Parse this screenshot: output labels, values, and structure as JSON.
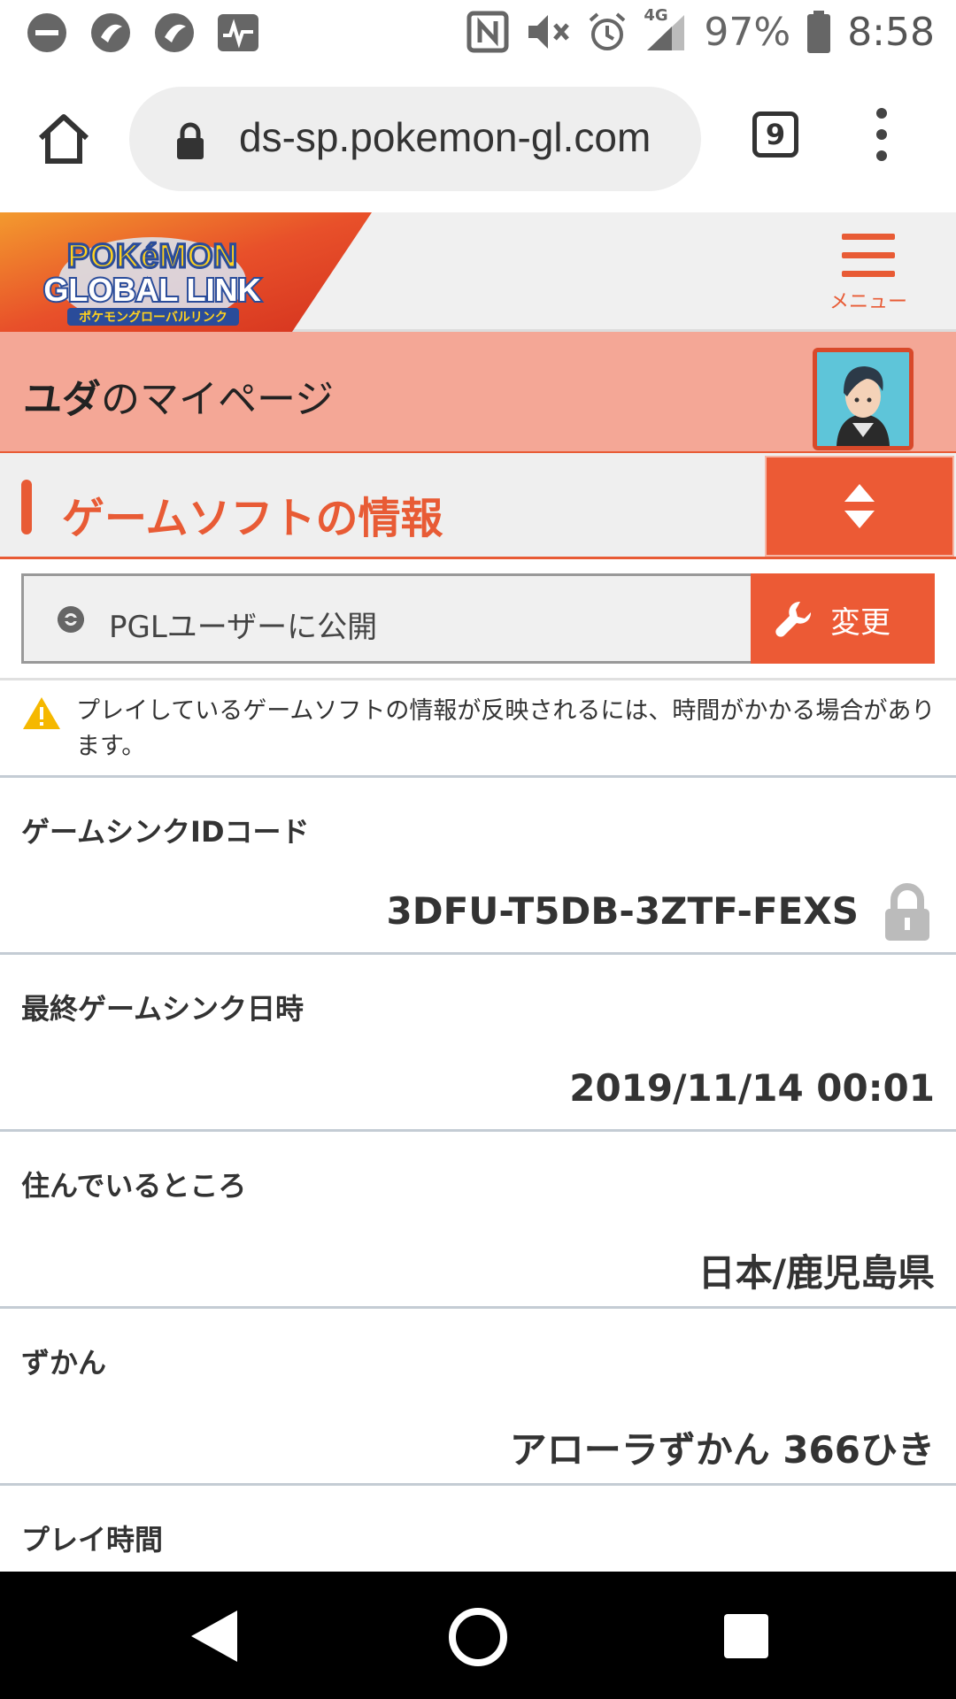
{
  "status_bar": {
    "icons_left": [
      "dnd-icon",
      "app-icon",
      "app-icon",
      "activity-icon"
    ],
    "icons_right": [
      "nfc-icon",
      "mute-icon",
      "alarm-icon",
      "signal-icon",
      "battery-icon"
    ],
    "network": "4G",
    "battery": "97%",
    "time": "8:58"
  },
  "browser": {
    "url": "ds-sp.pokemon-gl.com",
    "tab_count": "9"
  },
  "site_header": {
    "logo_line1": "POKéMON",
    "logo_line2": "GLOBAL LINK",
    "logo_line3": "ポケモングローバルリンク",
    "menu_label": "メニュー"
  },
  "mypage": {
    "username": "ユダ",
    "suffix": "のマイページ"
  },
  "section": {
    "title": "ゲームソフトの情報"
  },
  "visibility": {
    "label": "PGLユーザーに公開",
    "change_label": "変更"
  },
  "notice": {
    "text": "プレイしているゲームソフトの情報が反映されるには、時間がかかる場合があります。"
  },
  "info_rows": [
    {
      "label": "ゲームシンクIDコード",
      "value": "3DFU-T5DB-3ZTF-FEXS"
    },
    {
      "label": "最終ゲームシンク日時",
      "value": "2019/11/14 00:01"
    },
    {
      "label": "住んでいるところ",
      "value": "日本/鹿児島県"
    },
    {
      "label": "ずかん",
      "value": "アローラずかん 366ひき"
    },
    {
      "label": "プレイ時間",
      "value": ""
    }
  ],
  "colors": {
    "accent": "#ec5a35",
    "banner": "#f4a796",
    "header_bg": "#f0f0f0"
  }
}
